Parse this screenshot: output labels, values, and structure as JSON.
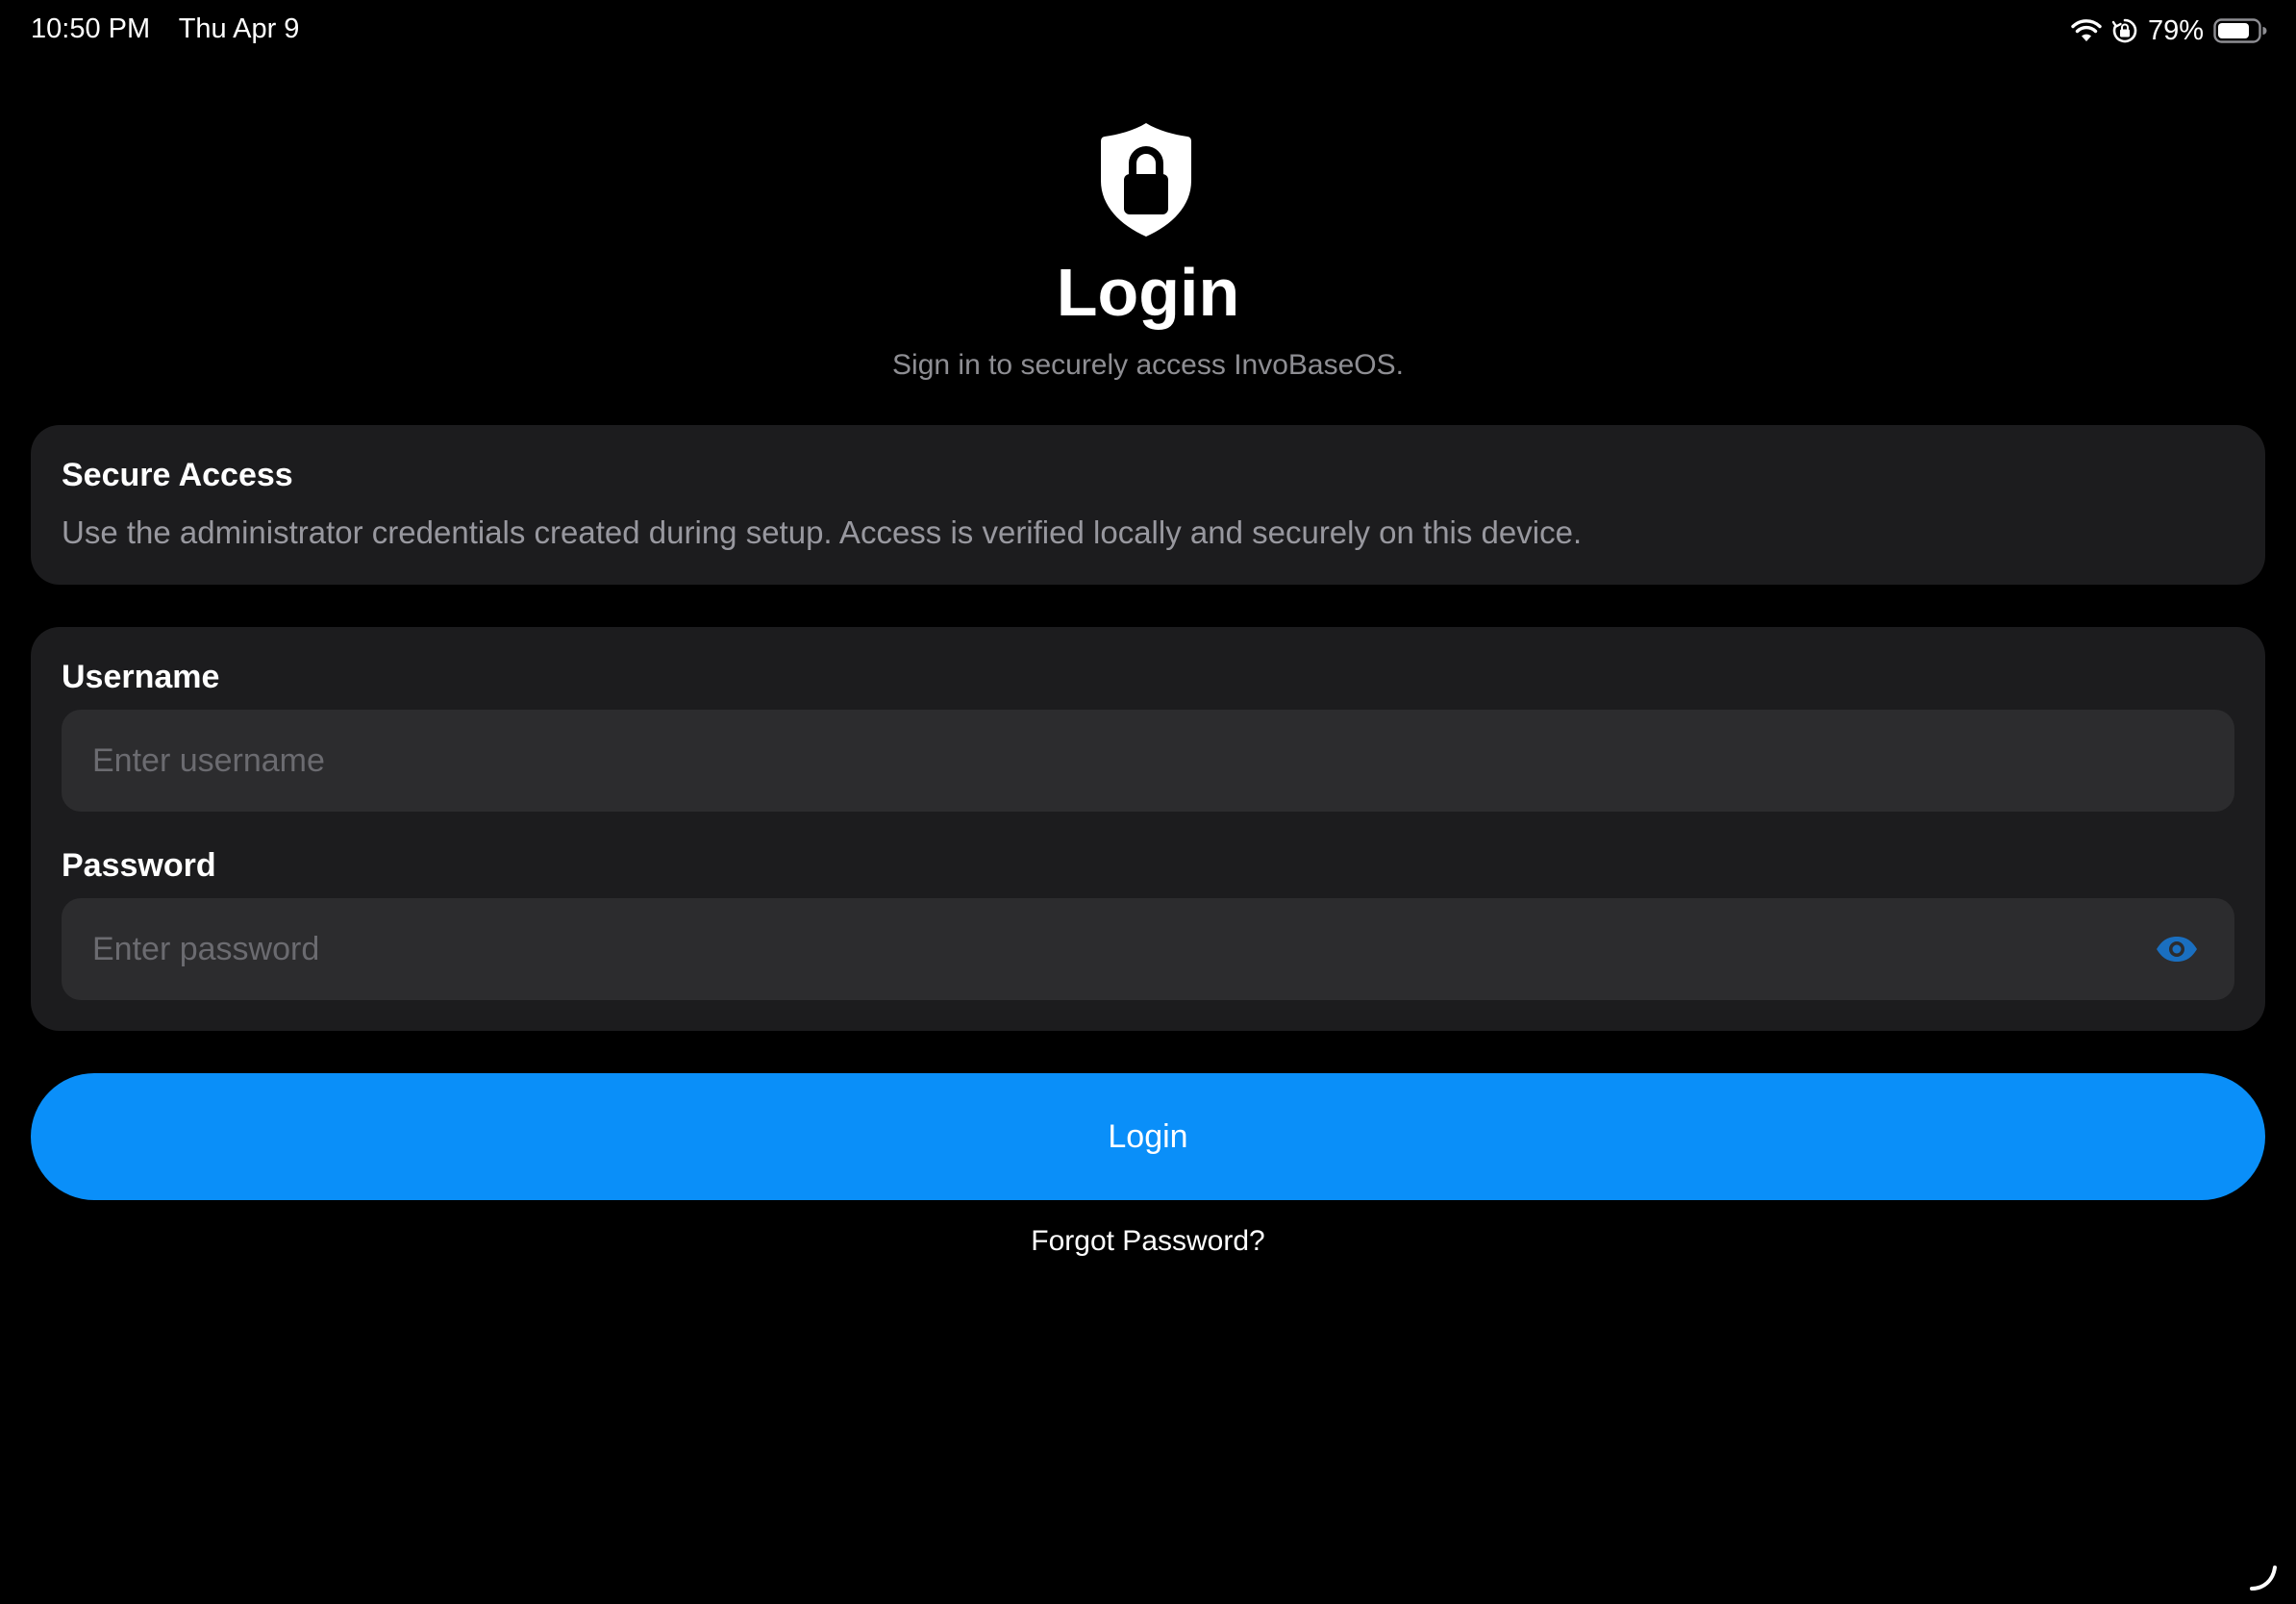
{
  "status_bar": {
    "time": "10:50 PM",
    "date": "Thu Apr 9",
    "battery": "79%",
    "icons": [
      "wifi-icon",
      "orientation-lock-icon",
      "battery-icon"
    ]
  },
  "header": {
    "icon": "shield-lock-icon",
    "title": "Login",
    "subtitle": "Sign in to securely access InvoBaseOS."
  },
  "secure_card": {
    "title": "Secure Access",
    "text": "Use the administrator credentials created during setup. Access is verified locally and securely on this device."
  },
  "form": {
    "username_label": "Username",
    "username_value": "",
    "username_placeholder": "Enter username",
    "password_label": "Password",
    "password_value": "",
    "password_placeholder": "Enter password",
    "password_toggle_icon": "eye-icon"
  },
  "actions": {
    "login_label": "Login",
    "forgot_label": "Forgot Password?"
  },
  "colors": {
    "background": "#000000",
    "card": "#1c1c1e",
    "input": "#2c2c2e",
    "accent": "#0a8ff9",
    "eye_icon": "#1a6fc0",
    "secondary_text": "#8e8e93"
  }
}
